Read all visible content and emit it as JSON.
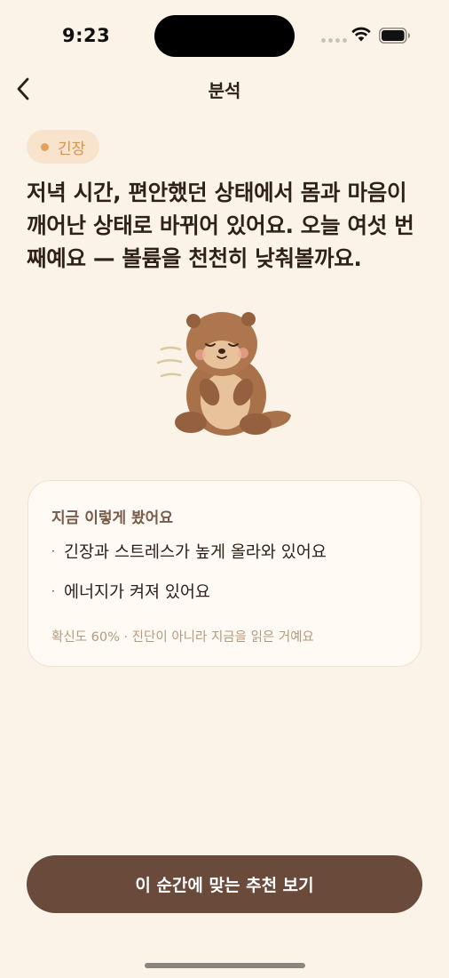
{
  "status_bar": {
    "time": "9:23"
  },
  "nav": {
    "title": "분석",
    "back_icon": "chevron-left-icon"
  },
  "emotion_chip": {
    "label": "긴장",
    "dot_color": "#e3a15c"
  },
  "headline": "저녁 시간, 편안했던 상태에서 몸과 마음이 깨어난 상태로 바뀌어 있어요. 오늘 여섯 번째예요 — 볼륨을 천천히 낮춰볼까요.",
  "illustration": {
    "icon": "otter-illustration"
  },
  "insight_card": {
    "title": "지금 이렇게 봤어요",
    "items": [
      {
        "bullet": "·",
        "text": "긴장과 스트레스가 높게 올라와 있어요"
      },
      {
        "bullet": "·",
        "text": "에너지가 켜져 있어요"
      }
    ],
    "footnote": "확신도 60% · 진단이 아니라 지금을 읽은 거예요"
  },
  "cta": {
    "label": "이 순간에 맞는 추천 보기",
    "color": "#6a4a3a"
  },
  "colors": {
    "background": "#fbf3e8",
    "accent": "#d9914c",
    "chip_bg": "#f8e4cc",
    "card_bg": "#fffbf4"
  }
}
